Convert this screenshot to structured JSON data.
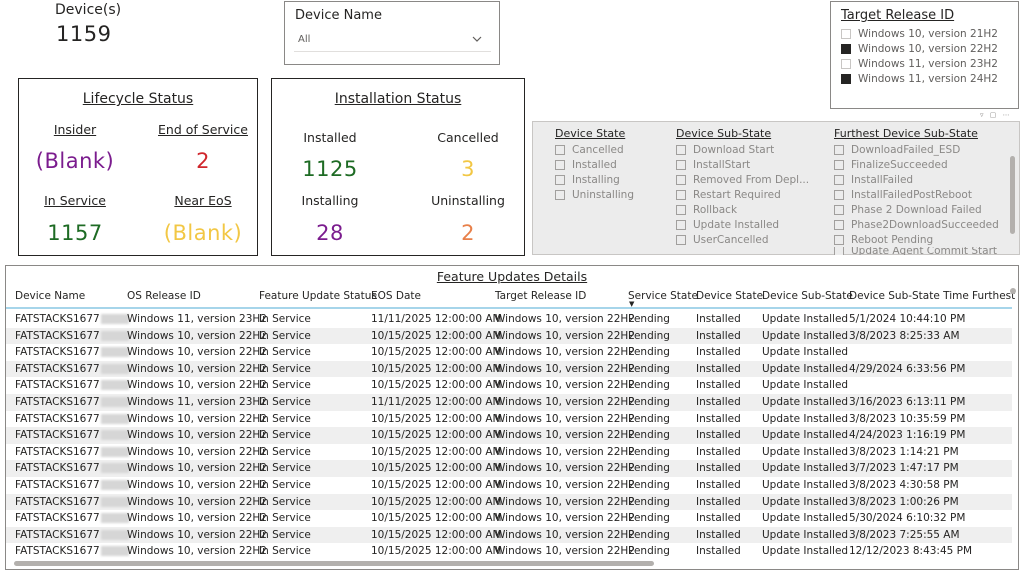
{
  "kpi": {
    "label": "Device(s)",
    "value": "1159"
  },
  "device_name_slicer": {
    "title": "Device Name",
    "selected": "All"
  },
  "target_release": {
    "title": "Target Release ID",
    "items": [
      {
        "label": "Windows 10, version 21H2",
        "checked": false
      },
      {
        "label": "Windows 10, version 22H2",
        "checked": true
      },
      {
        "label": "Windows 11, version 23H2",
        "checked": false
      },
      {
        "label": "Windows 11, version 24H2",
        "checked": true
      }
    ]
  },
  "lifecycle": {
    "title": "Lifecycle Status",
    "insider_label": "Insider",
    "insider_value": "(Blank)",
    "eos_label": "End of Service",
    "eos_value": "2",
    "inservice_label": "In Service",
    "inservice_value": "1157",
    "neareos_label": "Near EoS",
    "neareos_value": "(Blank)"
  },
  "installation": {
    "title": "Installation Status",
    "installed_label": "Installed",
    "installed_value": "1125",
    "cancelled_label": "Cancelled",
    "cancelled_value": "3",
    "installing_label": "Installing",
    "installing_value": "28",
    "uninstalling_label": "Uninstalling",
    "uninstalling_value": "2"
  },
  "colors": {
    "purple": "#7b1c8e",
    "red": "#d0262c",
    "green": "#1e6b24",
    "yellow": "#f2c744",
    "slicer_bg": "#ececec",
    "header_line": "#a6d5ea"
  },
  "state_slicer": {
    "device_state": {
      "title": "Device State",
      "items": [
        "Cancelled",
        "Installed",
        "Installing",
        "Uninstalling"
      ]
    },
    "device_substate": {
      "title": "Device Sub-State",
      "items": [
        "Download Start",
        "InstallStart",
        "Removed From Depl...",
        "Restart Required",
        "Rollback",
        "Update Installed",
        "UserCancelled"
      ]
    },
    "furthest_substate": {
      "title": "Furthest Device Sub-State",
      "items": [
        "DownloadFailed_ESD",
        "FinalizeSucceeded",
        "InstallFailed",
        "InstallFailedPostReboot",
        "Phase 2 Download Failed",
        "Phase2DownloadSucceeded",
        "Reboot Pending",
        "Update Agent Commit Start"
      ]
    }
  },
  "table": {
    "title": "Feature Updates Details",
    "columns": [
      "Device Name",
      "OS Release ID",
      "Feature Update Status",
      "EOS Date",
      "Target Release ID",
      "Service State",
      "Device State",
      "Device Sub-State",
      "Device Sub-State Time",
      "Furthest"
    ],
    "rows": [
      [
        "FATSTACKS1677",
        "Windows 11, version 23H2",
        "In Service",
        "11/11/2025 12:00:00 AM",
        "Windows 10, version 22H2",
        "Pending",
        "Installed",
        "Update Installed",
        "5/1/2024 10:44:10 PM"
      ],
      [
        "FATSTACKS1677",
        "Windows 10, version 22H2",
        "In Service",
        "10/15/2025 12:00:00 AM",
        "Windows 10, version 22H2",
        "Pending",
        "Installed",
        "Update Installed",
        "3/8/2023 8:25:33 AM"
      ],
      [
        "FATSTACKS1677",
        "Windows 10, version 22H2",
        "In Service",
        "10/15/2025 12:00:00 AM",
        "Windows 10, version 22H2",
        "Pending",
        "Installed",
        "Update Installed",
        ""
      ],
      [
        "FATSTACKS1677",
        "Windows 10, version 22H2",
        "In Service",
        "10/15/2025 12:00:00 AM",
        "Windows 10, version 22H2",
        "Pending",
        "Installed",
        "Update Installed",
        "4/29/2024 6:33:56 PM"
      ],
      [
        "FATSTACKS1677",
        "Windows 10, version 22H2",
        "In Service",
        "10/15/2025 12:00:00 AM",
        "Windows 10, version 22H2",
        "Pending",
        "Installed",
        "Update Installed",
        ""
      ],
      [
        "FATSTACKS1677",
        "Windows 11, version 23H2",
        "In Service",
        "11/11/2025 12:00:00 AM",
        "Windows 10, version 22H2",
        "Pending",
        "Installed",
        "Update Installed",
        "3/16/2023 6:13:11 PM"
      ],
      [
        "FATSTACKS1677",
        "Windows 10, version 22H2",
        "In Service",
        "10/15/2025 12:00:00 AM",
        "Windows 10, version 22H2",
        "Pending",
        "Installed",
        "Update Installed",
        "3/8/2023 10:35:59 PM"
      ],
      [
        "FATSTACKS1677",
        "Windows 10, version 22H2",
        "In Service",
        "10/15/2025 12:00:00 AM",
        "Windows 10, version 22H2",
        "Pending",
        "Installed",
        "Update Installed",
        "4/24/2023 1:16:19 PM"
      ],
      [
        "FATSTACKS1677",
        "Windows 10, version 22H2",
        "In Service",
        "10/15/2025 12:00:00 AM",
        "Windows 10, version 22H2",
        "Pending",
        "Installed",
        "Update Installed",
        "3/8/2023 1:14:21 PM"
      ],
      [
        "FATSTACKS1677",
        "Windows 10, version 22H2",
        "In Service",
        "10/15/2025 12:00:00 AM",
        "Windows 10, version 22H2",
        "Pending",
        "Installed",
        "Update Installed",
        "3/7/2023 1:47:17 PM"
      ],
      [
        "FATSTACKS1677",
        "Windows 10, version 22H2",
        "In Service",
        "10/15/2025 12:00:00 AM",
        "Windows 10, version 22H2",
        "Pending",
        "Installed",
        "Update Installed",
        "3/8/2023 4:30:58 PM"
      ],
      [
        "FATSTACKS1677",
        "Windows 10, version 22H2",
        "In Service",
        "10/15/2025 12:00:00 AM",
        "Windows 10, version 22H2",
        "Pending",
        "Installed",
        "Update Installed",
        "3/8/2023 1:00:26 PM"
      ],
      [
        "FATSTACKS1677",
        "Windows 10, version 22H2",
        "In Service",
        "10/15/2025 12:00:00 AM",
        "Windows 10, version 22H2",
        "Pending",
        "Installed",
        "Update Installed",
        "5/30/2024 6:10:32 PM"
      ],
      [
        "FATSTACKS1677",
        "Windows 10, version 22H2",
        "In Service",
        "10/15/2025 12:00:00 AM",
        "Windows 10, version 22H2",
        "Pending",
        "Installed",
        "Update Installed",
        "3/8/2023 7:25:55 AM"
      ],
      [
        "FATSTACKS1677",
        "Windows 10, version 22H2",
        "In Service",
        "10/15/2025 12:00:00 AM",
        "Windows 10, version 22H2",
        "Pending",
        "Installed",
        "Update Installed",
        "12/12/2023 8:43:45 PM"
      ]
    ]
  }
}
